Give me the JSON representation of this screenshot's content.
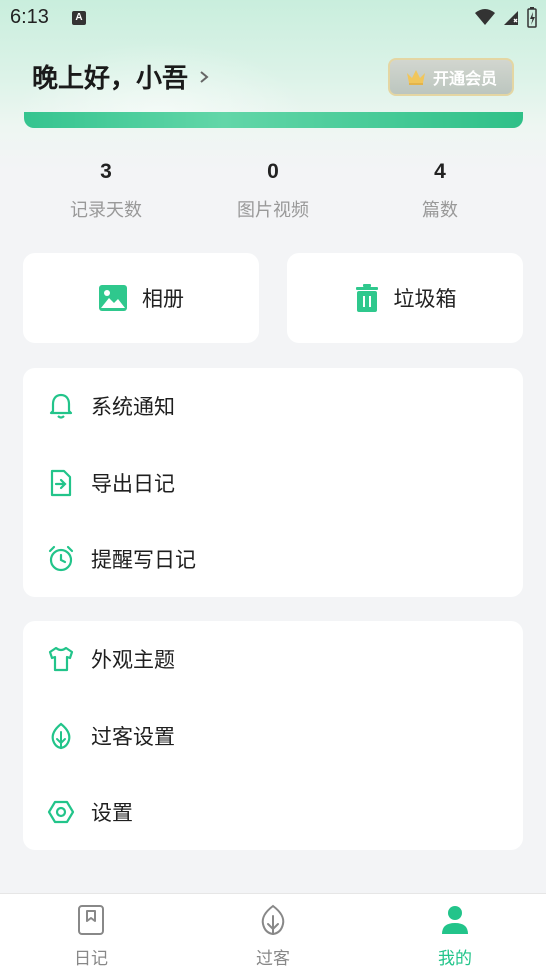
{
  "status_bar": {
    "time": "6:13",
    "notification_badge": "A"
  },
  "header": {
    "greeting": "晚上好，小吾",
    "vip_button": "开通会员"
  },
  "stats": [
    {
      "value": "3",
      "label": "记录天数"
    },
    {
      "value": "0",
      "label": "图片视频"
    },
    {
      "value": "4",
      "label": "篇数"
    }
  ],
  "quick_actions": {
    "album": "相册",
    "trash": "垃圾箱"
  },
  "menu_group_1": [
    {
      "label": "系统通知",
      "icon": "bell-icon"
    },
    {
      "label": "导出日记",
      "icon": "export-file-icon"
    },
    {
      "label": "提醒写日记",
      "icon": "alarm-clock-icon"
    }
  ],
  "menu_group_2": [
    {
      "label": "外观主题",
      "icon": "tshirt-icon"
    },
    {
      "label": "过客设置",
      "icon": "leaf-icon"
    },
    {
      "label": "设置",
      "icon": "hexagon-settings-icon"
    }
  ],
  "tabbar": [
    {
      "label": "日记",
      "icon": "diary-book-icon",
      "active": false
    },
    {
      "label": "过客",
      "icon": "leaf-icon",
      "active": false
    },
    {
      "label": "我的",
      "icon": "person-icon",
      "active": true
    }
  ],
  "colors": {
    "accent": "#22c48a",
    "background": "#f3f4f6",
    "muted_text": "#999999",
    "vip_border": "#e4d6a3"
  }
}
